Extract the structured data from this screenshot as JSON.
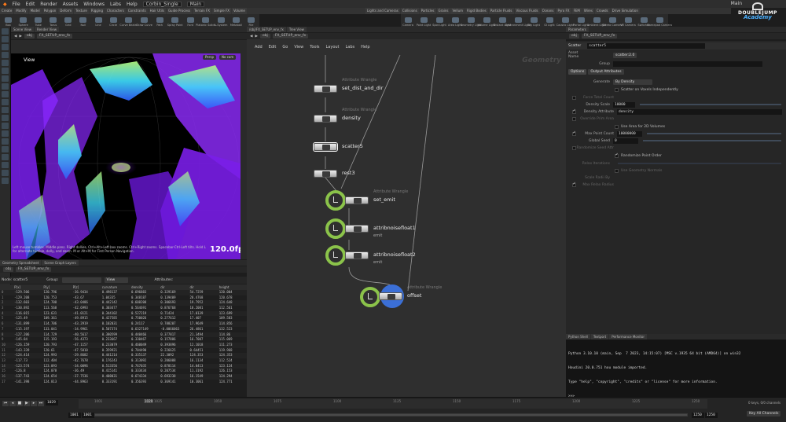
{
  "app": {
    "menu": [
      "File",
      "Edit",
      "Render",
      "Assets",
      "Windows",
      "Labs",
      "Help"
    ],
    "desktop": "Corbin_Single",
    "main_label": "Main",
    "user": "Main"
  },
  "brand": {
    "line1": "DOUBLEJUMP",
    "line2": "Academy"
  },
  "shelf": {
    "tools": [
      "Box",
      "Sphere",
      "Tube",
      "Torus",
      "Grid",
      "Null",
      "Line",
      "Circle",
      "Curve Bezier",
      "Draw Curve",
      "Path",
      "Spray Paint",
      "Font",
      "Platonic Solids",
      "L-System",
      "Metaball",
      "File",
      "Spiral",
      "Helix"
    ],
    "right_tools": [
      "Camera",
      "Point Light",
      "Spot Light",
      "Area Light",
      "Geometry Light",
      "Volume Light",
      "Distant Light",
      "Environment Light",
      "Sky Light",
      "GI Light",
      "Caustic Light",
      "Portal Light",
      "Ambient Light",
      "Stereo Camera",
      "VR Camera",
      "Switcher",
      "Gamepad Camera"
    ]
  },
  "viewport": {
    "tabs": [
      "Scene View",
      "Render View"
    ],
    "path": "obj",
    "node": "FX_SETUP_env_fx",
    "label": "View",
    "persp": "Persp",
    "cam": "No cam",
    "fps": "120.0fps",
    "hint": "Left mouse tumbles. Middle pans. Right dollies. Ctrl+Alt+Left box zooms. Ctrl+Right zooms. Spacebar-Ctrl-Left tilts. Hold L for alternate tumble, dolly, and zoom. M or Alt+M for First Person Navigation."
  },
  "spreadsheet": {
    "tabs": [
      "Geometry Spreadsheet",
      "Scene Graph Layers"
    ],
    "node_label": "Node: scatter5",
    "group_label": "Group:",
    "view_label": "View",
    "attributes_label": "Attributes:",
    "columns": [
      "",
      "P[x]",
      "P[y]",
      "P[z]",
      "curvature",
      "density",
      "dir",
      "",
      "",
      "dir",
      "height"
    ],
    "rows": [
      [
        "0",
        "-129.506",
        "120.796",
        "-36.9434",
        "0.498137",
        "0.696883",
        "0.329169",
        "54.7259",
        "120.004"
      ],
      [
        "1",
        "-129.208",
        "120.753",
        "-43.67",
        "1.04335",
        "0.348187",
        "0.139409",
        "28.4768",
        "120.678"
      ],
      [
        "2",
        "-132.603",
        "124.708",
        "-43.0486",
        "0.442142",
        "0.608208",
        "0.306693",
        "19.7952",
        "124.648"
      ],
      [
        "3",
        "-130.892",
        "113.568",
        "-42.6993",
        "0.303477",
        "0.564691",
        "0.876768",
        "18.2081",
        "112.561"
      ],
      [
        "4",
        "-116.015",
        "123.631",
        "-41.0121",
        "0.344102",
        "0.527219",
        "0.71434",
        "17.0139",
        "123.699"
      ],
      [
        "5",
        "-125.49",
        "109.361",
        "-49.8915",
        "0.427585",
        "0.750026",
        "0.277612",
        "17.407",
        "109.583"
      ],
      [
        "6",
        "-131.899",
        "114.706",
        "-43.2919",
        "0.102031",
        "0.24117",
        "0.788207",
        "17.9649",
        "114.856"
      ],
      [
        "7",
        "-115.197",
        "133.041",
        "-34.9961",
        "0.507374",
        "0.6327149",
        "-0.0066063",
        "26.4861",
        "132.523"
      ],
      [
        "8",
        "-127.206",
        "114.729",
        "-40.5617",
        "0.380599",
        "0.440466",
        "0.377817",
        "21.3494",
        "114.86"
      ],
      [
        "9",
        "-145.84",
        "115.193",
        "-56.4373",
        "0.233667",
        "0.330467",
        "0.157886",
        "16.7087",
        "115.069"
      ],
      [
        "10",
        "-126.159",
        "120.793",
        "-47.1157",
        "0.233079",
        "0.460049",
        "0.393896",
        "12.1018",
        "111.273"
      ],
      [
        "11",
        "-143.339",
        "120.61",
        "-47.5010",
        "0.359921",
        "0.704490",
        "0.226625",
        "0.64451",
        "119.968"
      ],
      [
        "12",
        "-124.414",
        "124.993",
        "-29.8682",
        "0.441214",
        "0.335137",
        "22.3092",
        "124.353",
        "124.353"
      ],
      [
        "13",
        "-117.73",
        "112.404",
        "-42.7678",
        "0.176243",
        "0.313092",
        "0.206008",
        "16.1134",
        "112.524"
      ],
      [
        "14",
        "-123.574",
        "123.093",
        "-34.0096",
        "0.513356",
        "0.767035",
        "0.878114",
        "14.0413",
        "123.124"
      ],
      [
        "15",
        "-126.8",
        "124.078",
        "-36.49",
        "0.415141",
        "0.333434",
        "0.207534",
        "11.3192",
        "126.153"
      ],
      [
        "16",
        "-137.743",
        "124.654",
        "-37.7536",
        "0.408031",
        "0.674334",
        "0.693238",
        "16.1549",
        "124.294"
      ],
      [
        "17",
        "-141.398",
        "124.813",
        "-44.8963",
        "0.333191",
        "0.356393",
        "0.369141",
        "10.3061",
        "124.771"
      ]
    ]
  },
  "network": {
    "tabs": [
      "/obj/FX_SETUP_env_fx",
      "Tree View"
    ],
    "path_node": "FX_SETUP_env_fx",
    "menu": [
      "Add",
      "Edit",
      "Go",
      "View",
      "Tools",
      "Layout",
      "Labs",
      "Help"
    ],
    "context_label": "Geometry",
    "nodes": [
      {
        "name": "set_dist_and_dir",
        "type": "Attribute Wrangle",
        "sub": ""
      },
      {
        "name": "density",
        "type": "Attribute Wrangle",
        "sub": ""
      },
      {
        "name": "scatter5",
        "type": "",
        "sub": ""
      },
      {
        "name": "rest3",
        "type": "",
        "sub": ""
      },
      {
        "name": "set_emit",
        "type": "Attribute Wrangle",
        "sub": ""
      },
      {
        "name": "attribnoisefloat1",
        "type": "",
        "sub": "emit"
      },
      {
        "name": "attribnoisefloat2",
        "type": "",
        "sub": "emit"
      },
      {
        "name": "offset",
        "type": "Attribute Wrangle",
        "sub": ""
      }
    ]
  },
  "params": {
    "node_type": "Scatter",
    "node_name": "scatter5",
    "asset_label": "Asset Name",
    "asset_value": "scatter:2.0",
    "group_label": "Group",
    "tabs": [
      "Options",
      "Output Attributes"
    ],
    "generate_label": "Generate",
    "generate_value": "By Density",
    "scatter_indep": "Scatter on Voxels Independently",
    "force_total_label": "Force Total Count",
    "density_scale_label": "Density Scale",
    "density_scale_value": "10000",
    "density_attr_label": "Density Attribute",
    "density_attr_value": "density",
    "override_label": "Override Prim Area",
    "use_area_label": "Use Area for 2D Volumes",
    "max_point_label": "Max Point Count",
    "max_point_value": "10000000",
    "global_seed_label": "Global Seed",
    "global_seed_value": "0",
    "random_seed_label": "Randomize Seed Attr",
    "randomize_point_label": "Randomize Point Order",
    "relax_label": "Relax Iterations",
    "use_geo_label": "Use Geometry Normals",
    "scale_radii_label": "Scale Radii By",
    "max_relax_label": "Max Relax Radius"
  },
  "python": {
    "tabs": [
      "Python Shell",
      "Textport",
      "Performance Monitor"
    ],
    "lines": [
      "Python 3.10.10 (main, Sep  7 2023, 14:15:07) [MSC v.1935 64 bit (AMD64)] on win32",
      "Houdini 20.0.751 hou module imported.",
      "Type \"help\", \"copyright\", \"credits\" or \"license\" for more information.",
      ">>>"
    ]
  },
  "timeline": {
    "current_frame": "1029",
    "start": "1001",
    "start2": "1001",
    "end": "1250",
    "end2": "1250",
    "ticks": [
      "1001",
      "1025",
      "1050",
      "1075",
      "1100",
      "1125",
      "1150",
      "1175",
      "1200",
      "1225",
      "1250"
    ],
    "keys_label": "0 keys, 0/0 channels",
    "channels_label": "Key All Channels"
  }
}
